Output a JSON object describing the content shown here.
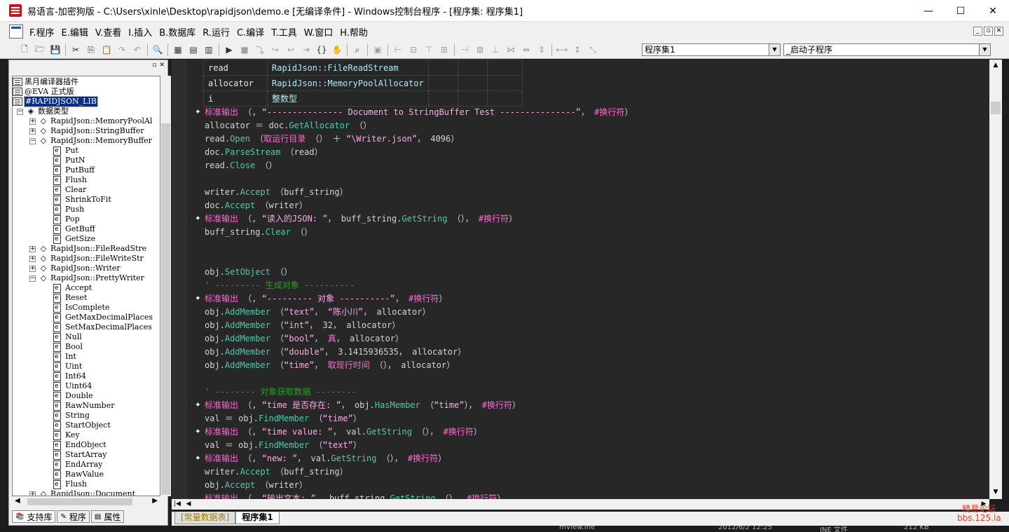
{
  "window": {
    "title": "易语言-加密狗版 - C:\\Users\\xinle\\Desktop\\rapidjson\\demo.e [无编译条件] - Windows控制台程序 - [程序集: 程序集1]",
    "minimize": "—",
    "maximize": "☐",
    "close": "✕"
  },
  "menu": [
    {
      "label": "F.程序"
    },
    {
      "label": "E.编辑"
    },
    {
      "label": "V.查看"
    },
    {
      "label": "I.插入"
    },
    {
      "label": "B.数据库"
    },
    {
      "label": "R.运行"
    },
    {
      "label": "C.编译"
    },
    {
      "label": "T.工具"
    },
    {
      "label": "W.窗口"
    },
    {
      "label": "H.帮助"
    }
  ],
  "mdi_controls": [
    "_",
    "▫",
    "✕"
  ],
  "toolbar": {
    "combo1": "程序集1",
    "combo2": "_启动子程序"
  },
  "tree": {
    "header_pin": "▫",
    "header_close": "✕",
    "items": [
      {
        "label": "黑月编译器插件",
        "kind": "book",
        "indent": 0
      },
      {
        "label": "@EVA 正式版",
        "kind": "book",
        "indent": 0
      },
      {
        "label": "#RAPIDJSON_LIB",
        "kind": "book",
        "indent": 0,
        "selected": true
      },
      {
        "label": "数据类型",
        "kind": "types",
        "indent": 1,
        "exp": "−"
      },
      {
        "label": "RapidJson::MemoryPoolAl",
        "kind": "diamond",
        "indent": 2,
        "exp": "+"
      },
      {
        "label": "RapidJson::StringBuffer",
        "kind": "diamond",
        "indent": 2,
        "exp": "+"
      },
      {
        "label": "RapidJson::MemoryBuffer",
        "kind": "diamond",
        "indent": 2,
        "exp": "−"
      },
      {
        "label": "Put",
        "kind": "page",
        "indent": 3
      },
      {
        "label": "PutN",
        "kind": "page",
        "indent": 3
      },
      {
        "label": "PutBuff",
        "kind": "page",
        "indent": 3
      },
      {
        "label": "Flush",
        "kind": "page",
        "indent": 3
      },
      {
        "label": "Clear",
        "kind": "page",
        "indent": 3
      },
      {
        "label": "ShrinkToFit",
        "kind": "page",
        "indent": 3
      },
      {
        "label": "Push",
        "kind": "page",
        "indent": 3
      },
      {
        "label": "Pop",
        "kind": "page",
        "indent": 3
      },
      {
        "label": "GetBuff",
        "kind": "page",
        "indent": 3
      },
      {
        "label": "GetSize",
        "kind": "page",
        "indent": 3
      },
      {
        "label": "RapidJson::FileReadStre",
        "kind": "diamond",
        "indent": 2,
        "exp": "+"
      },
      {
        "label": "RapidJson::FileWriteStr",
        "kind": "diamond",
        "indent": 2,
        "exp": "+"
      },
      {
        "label": "RapidJson::Writer",
        "kind": "diamond",
        "indent": 2,
        "exp": "+"
      },
      {
        "label": "RapidJson::PrettyWriter",
        "kind": "diamond",
        "indent": 2,
        "exp": "−"
      },
      {
        "label": "Accept",
        "kind": "page",
        "indent": 3
      },
      {
        "label": "Reset",
        "kind": "page",
        "indent": 3
      },
      {
        "label": "IsComplete",
        "kind": "page",
        "indent": 3
      },
      {
        "label": "GetMaxDecimalPlaces",
        "kind": "page",
        "indent": 3
      },
      {
        "label": "SetMaxDecimalPlaces",
        "kind": "page",
        "indent": 3
      },
      {
        "label": "Null",
        "kind": "page",
        "indent": 3
      },
      {
        "label": "Bool",
        "kind": "page",
        "indent": 3
      },
      {
        "label": "Int",
        "kind": "page",
        "indent": 3
      },
      {
        "label": "Uint",
        "kind": "page",
        "indent": 3
      },
      {
        "label": "Int64",
        "kind": "page",
        "indent": 3
      },
      {
        "label": "Uint64",
        "kind": "page",
        "indent": 3
      },
      {
        "label": "Double",
        "kind": "page",
        "indent": 3
      },
      {
        "label": "RawNumber",
        "kind": "page",
        "indent": 3
      },
      {
        "label": "String",
        "kind": "page",
        "indent": 3
      },
      {
        "label": "StartObject",
        "kind": "page",
        "indent": 3
      },
      {
        "label": "Key",
        "kind": "page",
        "indent": 3
      },
      {
        "label": "EndObject",
        "kind": "page",
        "indent": 3
      },
      {
        "label": "StartArray",
        "kind": "page",
        "indent": 3
      },
      {
        "label": "EndArray",
        "kind": "page",
        "indent": 3
      },
      {
        "label": "RawValue",
        "kind": "page",
        "indent": 3
      },
      {
        "label": "Flush",
        "kind": "page",
        "indent": 3
      },
      {
        "label": "RapidJson::Document",
        "kind": "diamond",
        "indent": 2,
        "exp": "+"
      }
    ]
  },
  "left_tabs": [
    {
      "label": "支持库",
      "active": true
    },
    {
      "label": "程序",
      "active": false
    },
    {
      "label": "属性",
      "active": false
    }
  ],
  "vartable": [
    {
      "name": "read",
      "type": "RapidJson::FileReadStream"
    },
    {
      "name": "allocator",
      "type": "RapidJson::MemoryPoolAllocator"
    },
    {
      "name": "i",
      "type": "整数型"
    }
  ],
  "code": [
    {
      "marker": true,
      "parts": [
        [
          "c-cmd",
          "标准输出"
        ],
        [
          "c-var",
          " （, "
        ],
        [
          "c-str",
          "“--------------- Document to StringBuffer Test ---------------”"
        ],
        [
          "c-var",
          "， "
        ],
        [
          "c-cmd",
          "#换行符"
        ],
        [
          "c-var",
          "）"
        ]
      ]
    },
    {
      "parts": [
        [
          "c-var",
          "allocator ＝ doc."
        ],
        [
          "c-method",
          "GetAllocator"
        ],
        [
          "c-var",
          " （）"
        ]
      ]
    },
    {
      "parts": [
        [
          "c-var",
          "read."
        ],
        [
          "c-method",
          "Open"
        ],
        [
          "c-var",
          " （"
        ],
        [
          "c-cmd",
          "取运行目录"
        ],
        [
          "c-var",
          " （） ＋ "
        ],
        [
          "c-str",
          "“\\Writer.json”"
        ],
        [
          "c-var",
          "， 4096）"
        ]
      ]
    },
    {
      "parts": [
        [
          "c-var",
          "doc."
        ],
        [
          "c-method",
          "ParseStream"
        ],
        [
          "c-var",
          " （read）"
        ]
      ]
    },
    {
      "parts": [
        [
          "c-var",
          "read."
        ],
        [
          "c-method",
          "Close"
        ],
        [
          "c-var",
          " （）"
        ]
      ]
    },
    {
      "parts": []
    },
    {
      "parts": [
        [
          "c-var",
          "writer."
        ],
        [
          "c-method",
          "Accept"
        ],
        [
          "c-var",
          " （buff_string）"
        ]
      ]
    },
    {
      "parts": [
        [
          "c-var",
          "doc."
        ],
        [
          "c-method",
          "Accept"
        ],
        [
          "c-var",
          " （writer）"
        ]
      ]
    },
    {
      "marker": true,
      "parts": [
        [
          "c-cmd",
          "标准输出"
        ],
        [
          "c-var",
          " （, "
        ],
        [
          "c-str",
          "“读入的JSON: ”"
        ],
        [
          "c-var",
          "， buff_string."
        ],
        [
          "c-method",
          "GetString"
        ],
        [
          "c-var",
          " （）， "
        ],
        [
          "c-cmd",
          "#换行符"
        ],
        [
          "c-var",
          "）"
        ]
      ]
    },
    {
      "parts": [
        [
          "c-var",
          "buff_string."
        ],
        [
          "c-method",
          "Clear"
        ],
        [
          "c-var",
          " （）"
        ]
      ]
    },
    {
      "parts": []
    },
    {
      "parts": []
    },
    {
      "parts": [
        [
          "c-var",
          "obj."
        ],
        [
          "c-method",
          "SetObject"
        ],
        [
          "c-var",
          " （）"
        ]
      ]
    },
    {
      "parts": [
        [
          "c-comment",
          "' --------- 生成对象 ----------"
        ]
      ]
    },
    {
      "marker": true,
      "parts": [
        [
          "c-cmd",
          "标准输出"
        ],
        [
          "c-var",
          " （, "
        ],
        [
          "c-str",
          "“--------- 对象 ----------”"
        ],
        [
          "c-var",
          "， "
        ],
        [
          "c-cmd",
          "#换行符"
        ],
        [
          "c-var",
          "）"
        ]
      ]
    },
    {
      "parts": [
        [
          "c-var",
          "obj."
        ],
        [
          "c-method",
          "AddMember"
        ],
        [
          "c-var",
          " （"
        ],
        [
          "c-str",
          "“text”"
        ],
        [
          "c-var",
          "， "
        ],
        [
          "c-str",
          "“陈小川”"
        ],
        [
          "c-var",
          "， allocator）"
        ]
      ]
    },
    {
      "parts": [
        [
          "c-var",
          "obj."
        ],
        [
          "c-method",
          "AddMember"
        ],
        [
          "c-var",
          " （"
        ],
        [
          "c-str",
          "“int”"
        ],
        [
          "c-var",
          "， 32， allocator）"
        ]
      ]
    },
    {
      "parts": [
        [
          "c-var",
          "obj."
        ],
        [
          "c-method",
          "AddMember"
        ],
        [
          "c-var",
          " （"
        ],
        [
          "c-str",
          "“bool”"
        ],
        [
          "c-var",
          "， "
        ],
        [
          "c-cmd",
          "真"
        ],
        [
          "c-var",
          "， allocator）"
        ]
      ]
    },
    {
      "parts": [
        [
          "c-var",
          "obj."
        ],
        [
          "c-method",
          "AddMember"
        ],
        [
          "c-var",
          " （"
        ],
        [
          "c-str",
          "“double”"
        ],
        [
          "c-var",
          "， 3.1415936535， allocator）"
        ]
      ]
    },
    {
      "parts": [
        [
          "c-var",
          "obj."
        ],
        [
          "c-method",
          "AddMember"
        ],
        [
          "c-var",
          " （"
        ],
        [
          "c-str",
          "“time”"
        ],
        [
          "c-var",
          "， "
        ],
        [
          "c-cmd",
          "取现行时间"
        ],
        [
          "c-var",
          " （）， allocator）"
        ]
      ]
    },
    {
      "parts": []
    },
    {
      "parts": [
        [
          "c-comment",
          "' -------- 对象获取数据 --------"
        ]
      ]
    },
    {
      "marker": true,
      "parts": [
        [
          "c-cmd",
          "标准输出"
        ],
        [
          "c-var",
          " （, "
        ],
        [
          "c-str",
          "“time 是否存在: ”"
        ],
        [
          "c-var",
          "， obj."
        ],
        [
          "c-method",
          "HasMember"
        ],
        [
          "c-var",
          " （"
        ],
        [
          "c-str",
          "“time”"
        ],
        [
          "c-var",
          "）， "
        ],
        [
          "c-cmd",
          "#换行符"
        ],
        [
          "c-var",
          "）"
        ]
      ]
    },
    {
      "parts": [
        [
          "c-var",
          "val ＝ obj."
        ],
        [
          "c-method",
          "FindMember"
        ],
        [
          "c-var",
          " （"
        ],
        [
          "c-str",
          "“time”"
        ],
        [
          "c-var",
          "）"
        ]
      ]
    },
    {
      "marker": true,
      "parts": [
        [
          "c-cmd",
          "标准输出"
        ],
        [
          "c-var",
          " （, "
        ],
        [
          "c-str",
          "“time value: ”"
        ],
        [
          "c-var",
          "， val."
        ],
        [
          "c-method",
          "GetString"
        ],
        [
          "c-var",
          " （）， "
        ],
        [
          "c-cmd",
          "#换行符"
        ],
        [
          "c-var",
          "）"
        ]
      ]
    },
    {
      "parts": [
        [
          "c-var",
          "val ＝ obj."
        ],
        [
          "c-method",
          "FindMember"
        ],
        [
          "c-var",
          " （"
        ],
        [
          "c-str",
          "“text”"
        ],
        [
          "c-var",
          "）"
        ]
      ]
    },
    {
      "marker": true,
      "parts": [
        [
          "c-cmd",
          "标准输出"
        ],
        [
          "c-var",
          " （, "
        ],
        [
          "c-str",
          "“new: ”"
        ],
        [
          "c-var",
          "， val."
        ],
        [
          "c-method",
          "GetString"
        ],
        [
          "c-var",
          " （）， "
        ],
        [
          "c-cmd",
          "#换行符"
        ],
        [
          "c-var",
          "）"
        ]
      ]
    },
    {
      "parts": [
        [
          "c-var",
          "writer."
        ],
        [
          "c-method",
          "Accept"
        ],
        [
          "c-var",
          " （buff_string）"
        ]
      ]
    },
    {
      "parts": [
        [
          "c-var",
          "obj."
        ],
        [
          "c-method",
          "Accept"
        ],
        [
          "c-var",
          " （writer）"
        ]
      ]
    },
    {
      "parts": [
        [
          "c-cmd",
          "标准输出"
        ],
        [
          "c-var",
          " （, "
        ],
        [
          "c-str",
          "“输出文本: ”"
        ],
        [
          "c-var",
          "， buff_string."
        ],
        [
          "c-method",
          "GetString"
        ],
        [
          "c-var",
          " （）， "
        ],
        [
          "c-cmd",
          "#换行符"
        ],
        [
          "c-var",
          "）"
        ]
      ]
    }
  ],
  "editor_tabs": [
    {
      "label": "[常量数据表]",
      "active": false
    },
    {
      "label": "程序集1",
      "active": true
    }
  ],
  "watermark": {
    "line1": "精易论坛",
    "line2": "bbs.125.la"
  },
  "background_status": {
    "file": "mView.ine",
    "date": "2012/6/2 12:25",
    "type": "INE 文件",
    "size": "212 KB"
  }
}
